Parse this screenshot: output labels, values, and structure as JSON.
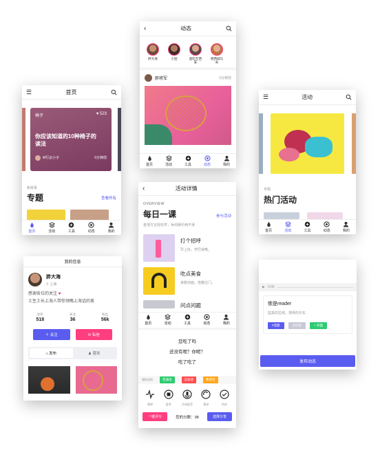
{
  "colors": {
    "accent": "#5a5cf0",
    "pink": "#ff3d7f",
    "green": "#2ecc71",
    "red": "#ff4d4f",
    "orange": "#ffa81c"
  },
  "tabbar": [
    "首页",
    "活动",
    "工具",
    "动态",
    "我的"
  ],
  "feed": {
    "title": "动态",
    "users": [
      {
        "name": "胖大海"
      },
      {
        "name": "小团"
      },
      {
        "name": "超吃在西安"
      },
      {
        "name": "阴西城马永"
      }
    ],
    "post": {
      "author": "胖将军",
      "time": "5分钟前"
    }
  },
  "home": {
    "title": "首页",
    "card": {
      "tag": "椅子",
      "likes": "523",
      "title": "你应该知道的10种椅子的读法",
      "author": "M行云小子",
      "time": "5分钟前"
    },
    "section": {
      "sub": "新鲜事",
      "title": "专题",
      "more": "查看所有"
    }
  },
  "activity": {
    "title": "活动",
    "section": {
      "sub": "专题",
      "title": "热门活动"
    }
  },
  "detail": {
    "title": "活动详情",
    "overview": "OVERVIEW",
    "heading": "每日一课",
    "join": "参与活动",
    "desc": "各地方言轻松学，休闲娱乐两不误",
    "items": [
      {
        "title": "打个招呼",
        "sub": "早上好，学巴得嘞。"
      },
      {
        "title": "吃点美食",
        "sub": "来碗凉面，塔棚过门。"
      },
      {
        "title": "问点问题",
        "sub": ""
      }
    ]
  },
  "profile": {
    "title": "我的信息",
    "name": "胖大海",
    "location": "上海",
    "bio1": "感谢各位的关注",
    "bio2": "土生土长上海人带你领略上海话的美",
    "stats": [
      {
        "label": "发布",
        "value": "518"
      },
      {
        "label": "关注",
        "value": "36"
      },
      {
        "label": "粉丝",
        "value": "56k"
      }
    ],
    "follow": "关注",
    "message": "私信",
    "tabs": [
      "发布",
      "喜欢"
    ]
  },
  "practice": {
    "lines": [
      "您吃了吗",
      "还没有呢？你呢？",
      "吃了吃了"
    ],
    "tags_label": "模拟语境",
    "tags": [
      "普通话",
      "吴语话",
      "粤语话"
    ],
    "tools": [
      "删除",
      "暂停",
      "开始配音",
      "重录",
      "完成"
    ],
    "rate": "一键评分",
    "score_label": "您的分数：",
    "score": "98",
    "share": "选择分享"
  },
  "publish": {
    "time": "0:00",
    "title": "侬是reader",
    "sub": "篮黑的拉绒，落咧的乐东",
    "tags": [
      "#话题",
      "@好友",
      "+ 封面"
    ],
    "button": "发布动态"
  }
}
